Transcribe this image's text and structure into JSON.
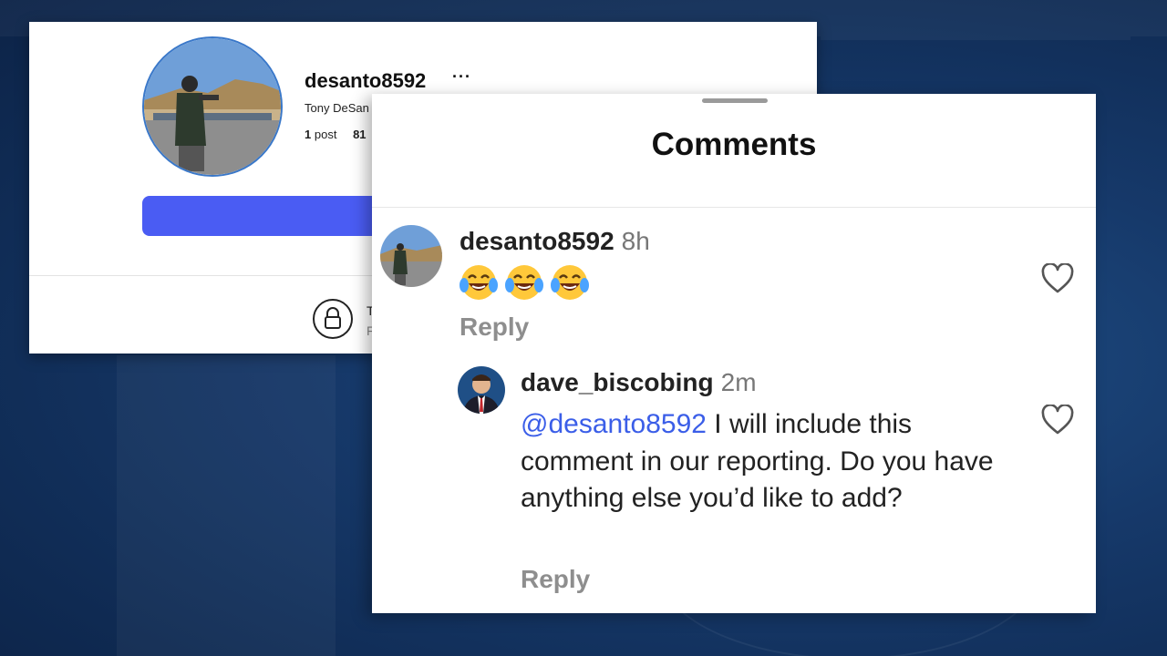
{
  "profile": {
    "username": "desanto8592",
    "more_label": "···",
    "full_name": "Tony DeSan",
    "stats": {
      "posts_count": "1",
      "posts_label": "post",
      "followers_count": "81"
    },
    "private_notice_line1": "T",
    "private_notice_line2": "F"
  },
  "comments_sheet": {
    "title": "Comments",
    "comments": [
      {
        "username": "desanto8592",
        "time": "8h",
        "text": "😂😂😂",
        "reply_label": "Reply"
      },
      {
        "username": "dave_biscobing",
        "time": "2m",
        "mention": "@desanto8592",
        "text": " I will include this comment in our reporting. Do you have anything else you’d like to add?",
        "reply_label": "Reply"
      }
    ]
  },
  "colors": {
    "follow_button": "#4a5cf3",
    "mention": "#3b5ee8",
    "background": "#16396a"
  },
  "icons": {
    "more": "ellipsis-icon",
    "private": "lock-icon",
    "like": "heart-icon",
    "emoji": "face-with-tears-of-joy"
  }
}
